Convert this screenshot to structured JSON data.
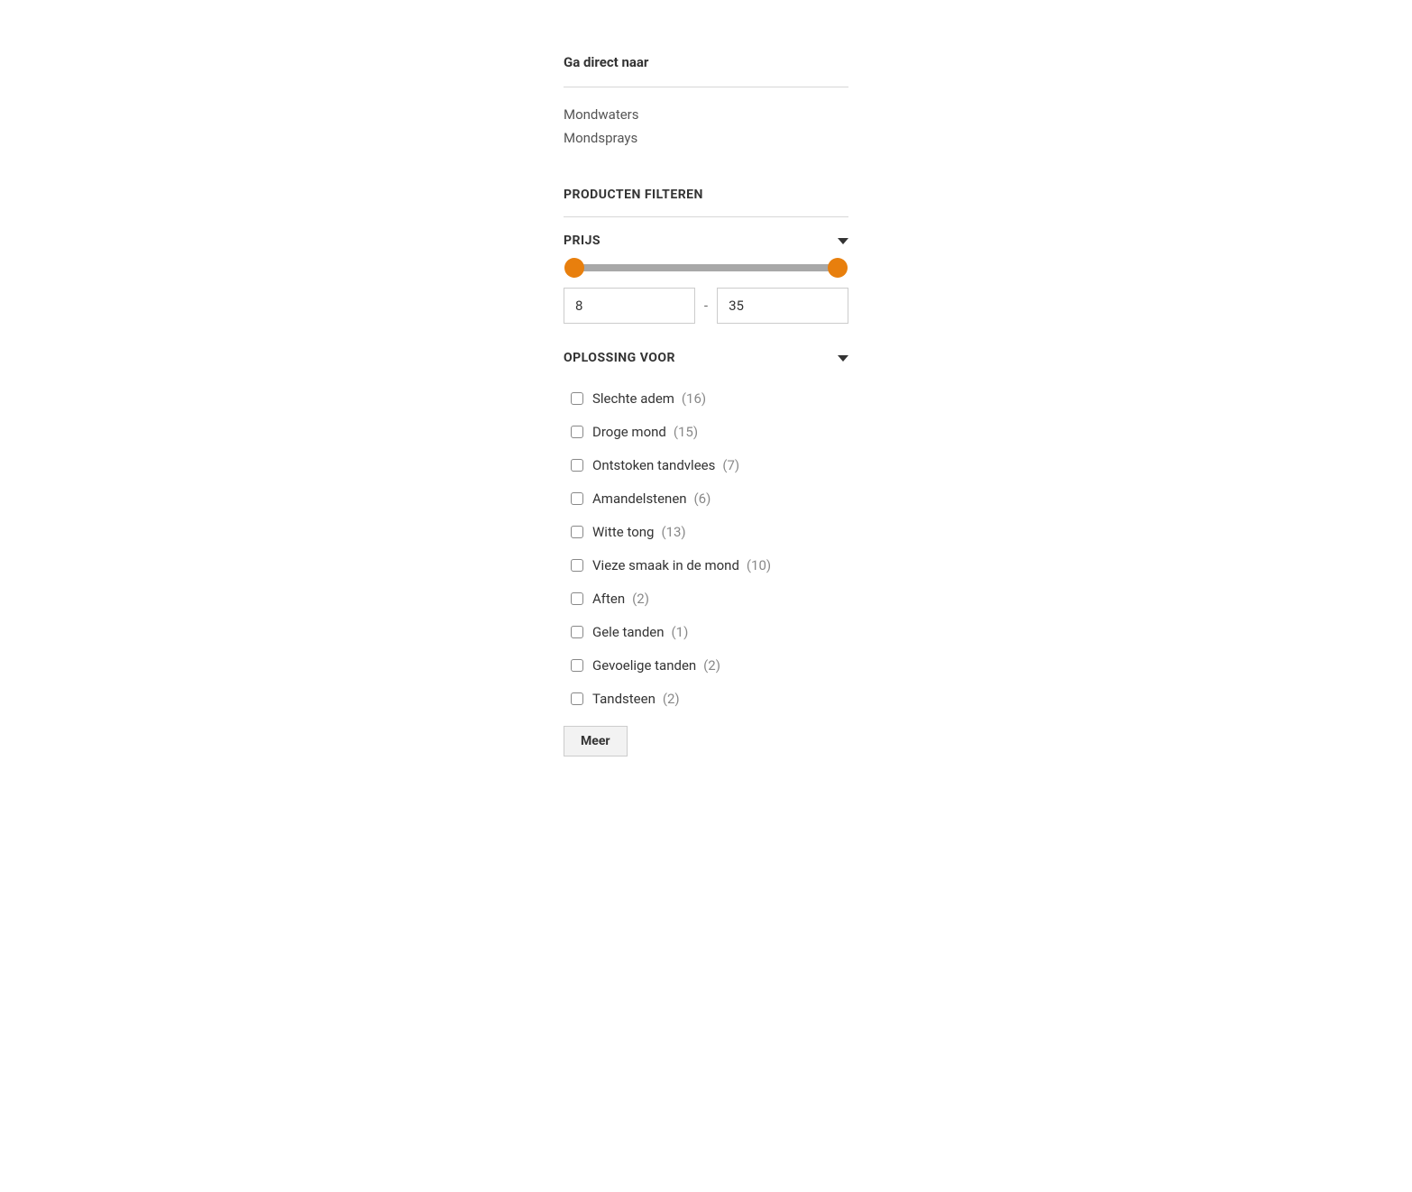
{
  "direct_nav": {
    "title": "Ga direct naar",
    "links": [
      "Mondwaters",
      "Mondsprays"
    ]
  },
  "filters": {
    "header": "PRODUCTEN FILTEREN",
    "price": {
      "title": "PRIJS",
      "min": "8",
      "max": "35",
      "separator": "-"
    },
    "solution": {
      "title": "OPLOSSING VOOR",
      "options": [
        {
          "label": "Slechte adem",
          "count": "(16)"
        },
        {
          "label": "Droge mond",
          "count": "(15)"
        },
        {
          "label": "Ontstoken tandvlees",
          "count": "(7)"
        },
        {
          "label": "Amandelstenen",
          "count": "(6)"
        },
        {
          "label": "Witte tong",
          "count": "(13)"
        },
        {
          "label": "Vieze smaak in de mond",
          "count": "(10)"
        },
        {
          "label": "Aften",
          "count": "(2)"
        },
        {
          "label": "Gele tanden",
          "count": "(1)"
        },
        {
          "label": "Gevoelige tanden",
          "count": "(2)"
        },
        {
          "label": "Tandsteen",
          "count": "(2)"
        }
      ],
      "more_label": "Meer"
    }
  }
}
